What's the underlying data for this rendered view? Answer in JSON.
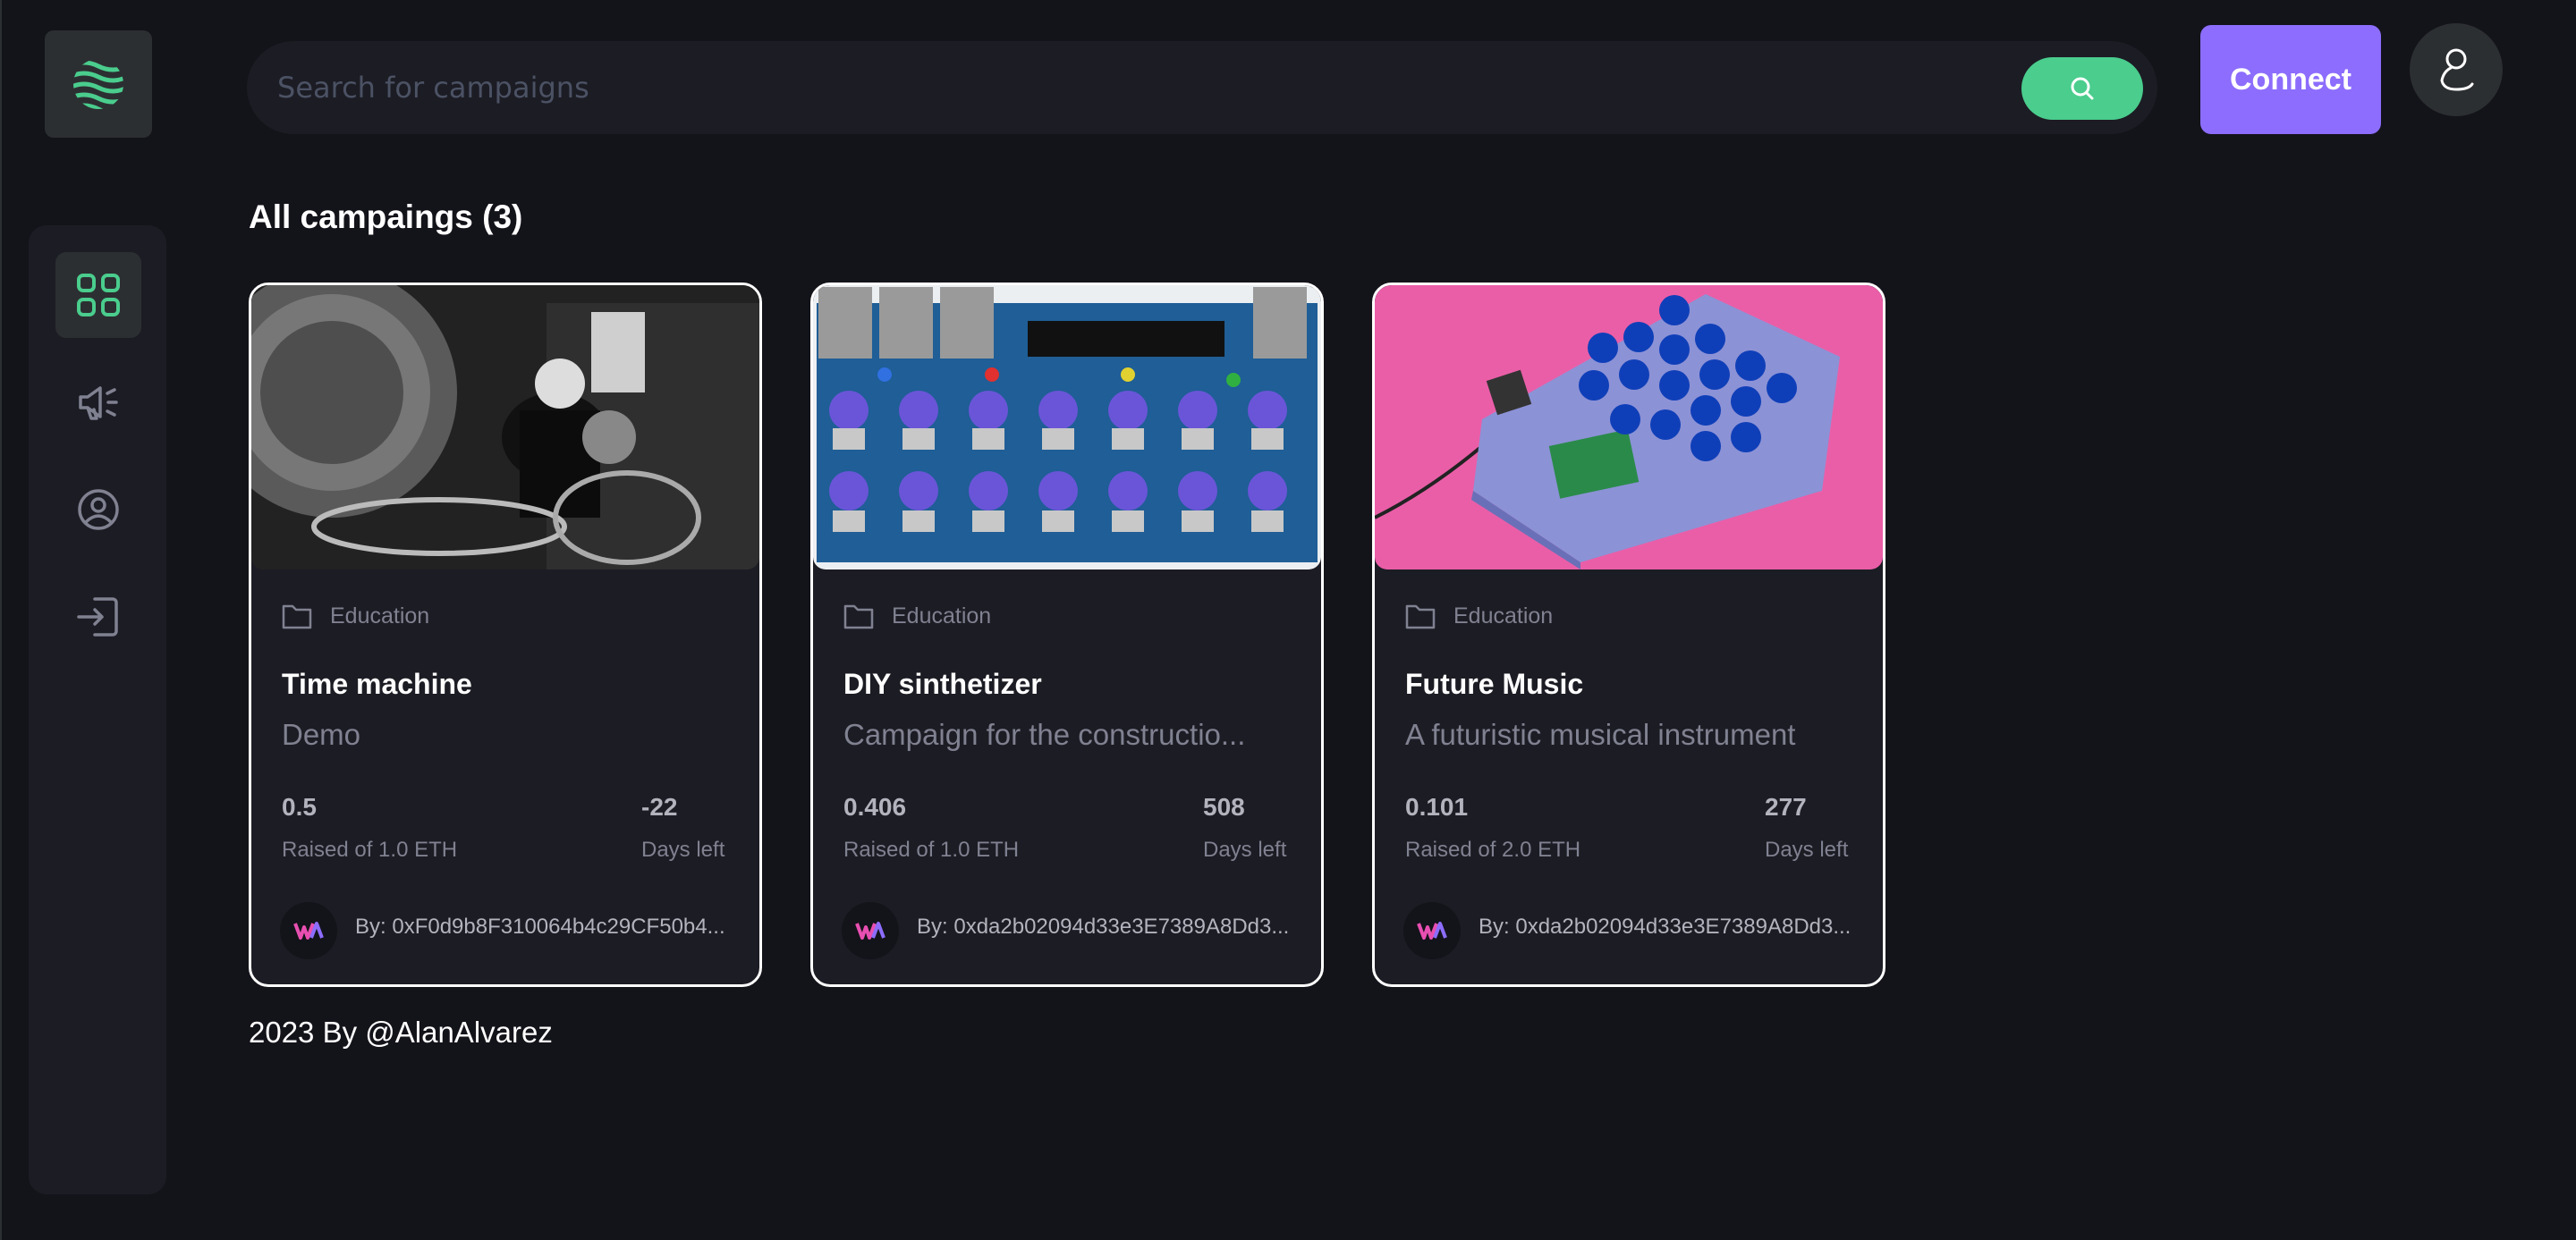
{
  "colors": {
    "background": "#13131a",
    "panel": "#1c1c24",
    "accent_green": "#4acd8d",
    "accent_purple": "#8c6dfd",
    "muted_text": "#808191"
  },
  "sidebar": {
    "logo_icon": "wave-globe-logo",
    "items": [
      {
        "icon": "dashboard-grid-icon",
        "active": true
      },
      {
        "icon": "megaphone-icon",
        "active": false
      },
      {
        "icon": "profile-icon",
        "active": false
      },
      {
        "icon": "logout-icon",
        "active": false
      }
    ]
  },
  "header": {
    "search_placeholder": "Search for campaigns",
    "search_icon": "search-icon",
    "connect_label": "Connect",
    "avatar_icon": "user-avatar-icon"
  },
  "main": {
    "section_title": "All campaings (3)",
    "campaigns": [
      {
        "category": "Education",
        "title": "Time machine",
        "description": "Demo",
        "raised": "0.5",
        "raised_label": "Raised of 1.0 ETH",
        "days": "-22",
        "days_label": "Days left",
        "owner": "By: 0xF0d9b8F310064b4c29CF50b4..."
      },
      {
        "category": "Education",
        "title": "DIY sinthetizer",
        "description": "Campaign for the constructio...",
        "raised": "0.406",
        "raised_label": "Raised of 1.0 ETH",
        "days": "508",
        "days_label": "Days left",
        "owner": "By: 0xda2b02094d33e3E7389A8Dd3..."
      },
      {
        "category": "Education",
        "title": "Future Music",
        "description": "A futuristic musical instrument",
        "raised": "0.101",
        "raised_label": "Raised of 2.0 ETH",
        "days": "277",
        "days_label": "Days left",
        "owner": "By: 0xda2b02094d33e3E7389A8Dd3..."
      }
    ]
  },
  "footer": {
    "text": "2023 By @AlanAlvarez"
  }
}
